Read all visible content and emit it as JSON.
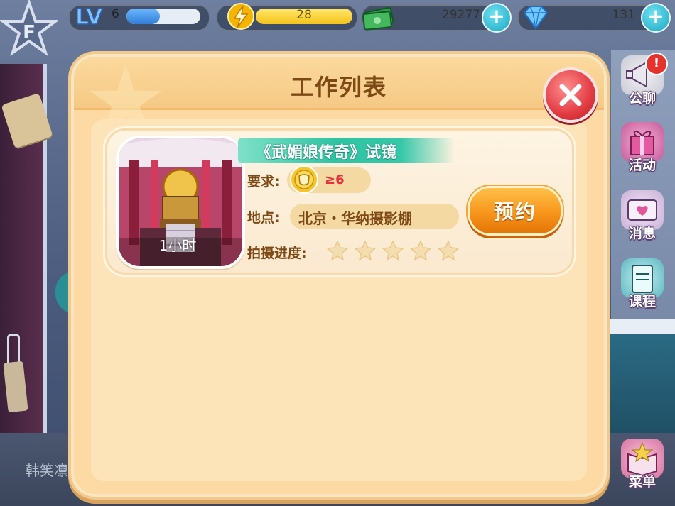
{
  "hud": {
    "level_label": "LV",
    "level": "6",
    "level_progress": 0.45,
    "energy": "28",
    "money": "29277",
    "gems": "131"
  },
  "side_menu": {
    "items": [
      {
        "label": "公聊",
        "icon": "megaphone-icon",
        "alert": "!"
      },
      {
        "label": "活动",
        "icon": "gift-icon"
      },
      {
        "label": "消息",
        "icon": "heart-message-icon"
      },
      {
        "label": "课程",
        "icon": "clipboard-icon"
      }
    ],
    "menu_label": "菜单"
  },
  "player_name": "韩笑凛",
  "modal": {
    "title": "工作列表"
  },
  "job": {
    "title": "《武媚娘传奇》试镜",
    "duration": "1小时",
    "requirement_label": "要求:",
    "requirement_value": "≥6",
    "location_label": "地点:",
    "location_value": "北京・华纳摄影棚",
    "progress_label": "拍摄进度:",
    "progress_stars_filled": 0,
    "progress_stars_total": 5,
    "book_label": "预约"
  },
  "colors": {
    "modal_bg": "#fdd9a4",
    "title_text": "#7d4a16",
    "ribbon": "#2fc4a3",
    "book_button": "#f7951b",
    "close_button": "#e23b42",
    "requirement_value": "#e8313c"
  }
}
